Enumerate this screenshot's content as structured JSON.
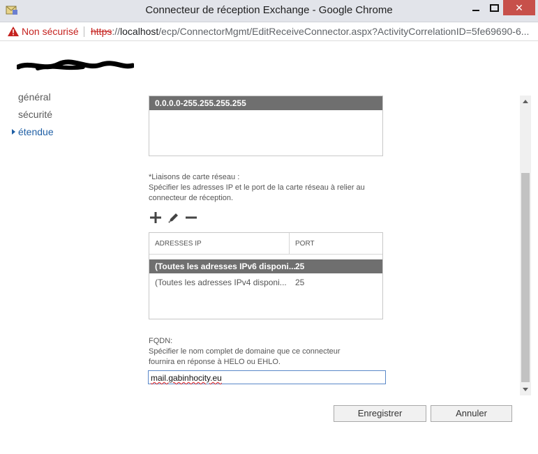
{
  "window": {
    "title": "Connecteur de réception Exchange - Google Chrome",
    "close_glyph": "✕"
  },
  "addressbar": {
    "security_label": "Non sécurisé",
    "url_scheme": "https",
    "url_separator": "://",
    "url_host": "localhost",
    "url_rest": "/ecp/ConnectorMgmt/EditReceiveConnector.aspx?ActivityCorrelationID=5fe69690-6..."
  },
  "nav": {
    "items": [
      {
        "label": "général"
      },
      {
        "label": "sécurité"
      },
      {
        "label": "étendue"
      }
    ]
  },
  "remote_ranges": {
    "rows": [
      "0.0.0.0-255.255.255.255"
    ]
  },
  "bindings": {
    "title": "*Liaisons de carte réseau :",
    "description_line1": "Spécifier les adresses IP et le port de la carte réseau à relier au",
    "description_line2": "connecteur de réception.",
    "columns": {
      "ip": "ADRESSES IP",
      "port": "PORT"
    },
    "rows": [
      {
        "ip": "(Toutes les adresses IPv6 disponi...",
        "port": "25",
        "selected": true
      },
      {
        "ip": "(Toutes les adresses IPv4 disponi...",
        "port": "25",
        "selected": false
      }
    ]
  },
  "fqdn": {
    "title": "FQDN:",
    "description_line1": "Spécifier le nom complet de domaine que ce connecteur",
    "description_line2": "fournira en réponse à HELO ou EHLO.",
    "value": "mail.gabinhocity.eu"
  },
  "buttons": {
    "save": "Enregistrer",
    "cancel": "Annuler"
  },
  "icons": [
    "app-icon",
    "warning-icon",
    "add-icon",
    "edit-icon",
    "remove-icon"
  ],
  "colors": {
    "selection": "#6f6f6f",
    "nav_active": "#1f5fa5",
    "insecure": "#c5221f"
  }
}
